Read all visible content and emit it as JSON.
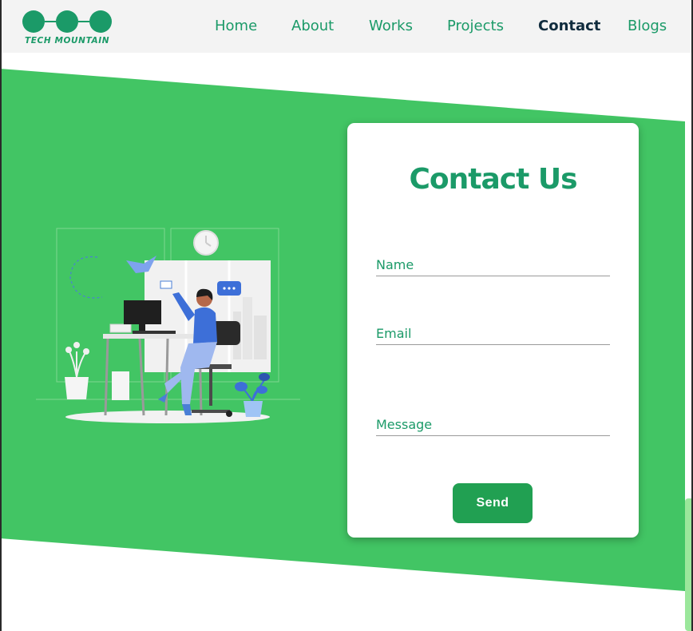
{
  "header": {
    "logo_text": "TECH MOUNTAIN",
    "nav": [
      {
        "label": "Home"
      },
      {
        "label": "About"
      },
      {
        "label": "Works"
      },
      {
        "label": "Projects"
      },
      {
        "label": "Contact"
      },
      {
        "label": "Blogs"
      }
    ],
    "active_nav": "Contact"
  },
  "contact": {
    "title": "Contact Us",
    "name_placeholder": "Name",
    "email_placeholder": "Email",
    "message_placeholder": "Message",
    "send_label": "Send"
  },
  "colors": {
    "brand_green": "#1b9a68",
    "band_green": "#42c564",
    "button_green": "#21a052",
    "active_nav": "#0f2b3d"
  }
}
